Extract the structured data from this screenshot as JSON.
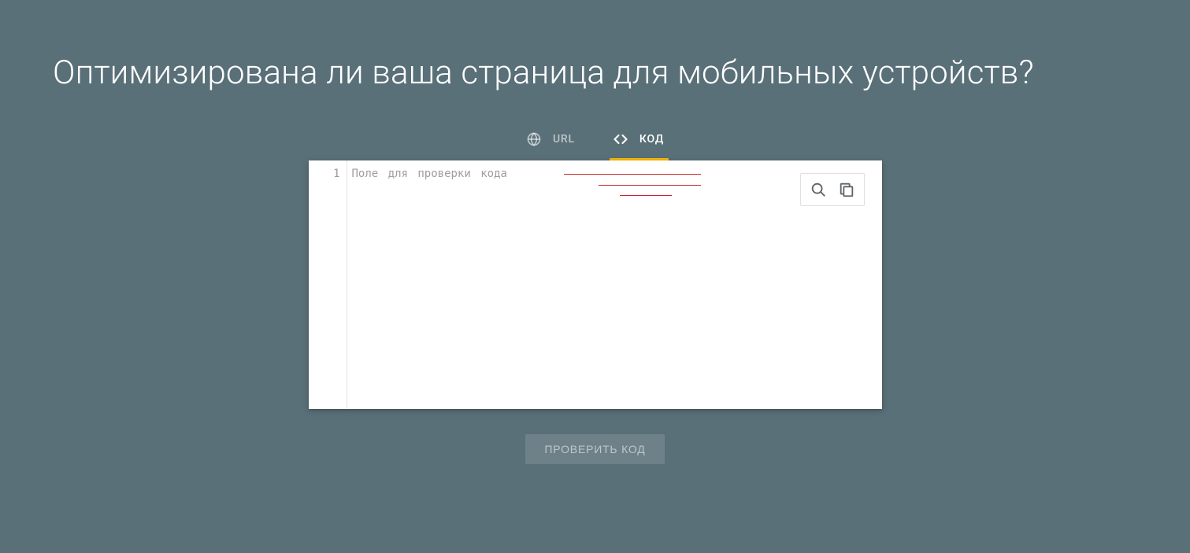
{
  "page": {
    "title": "Оптимизирована ли ваша страница для мобильных устройств?"
  },
  "tabs": {
    "url": {
      "label": "URL"
    },
    "code": {
      "label": "КОД"
    }
  },
  "editor": {
    "placeholder": "Поле для проверки кода",
    "value": "",
    "gutter": {
      "line1": "1"
    }
  },
  "toolbar": {
    "search_icon": "search-icon",
    "copy_icon": "copy-icon"
  },
  "actions": {
    "test_code_label": "ПРОВЕРИТЬ КОД"
  }
}
